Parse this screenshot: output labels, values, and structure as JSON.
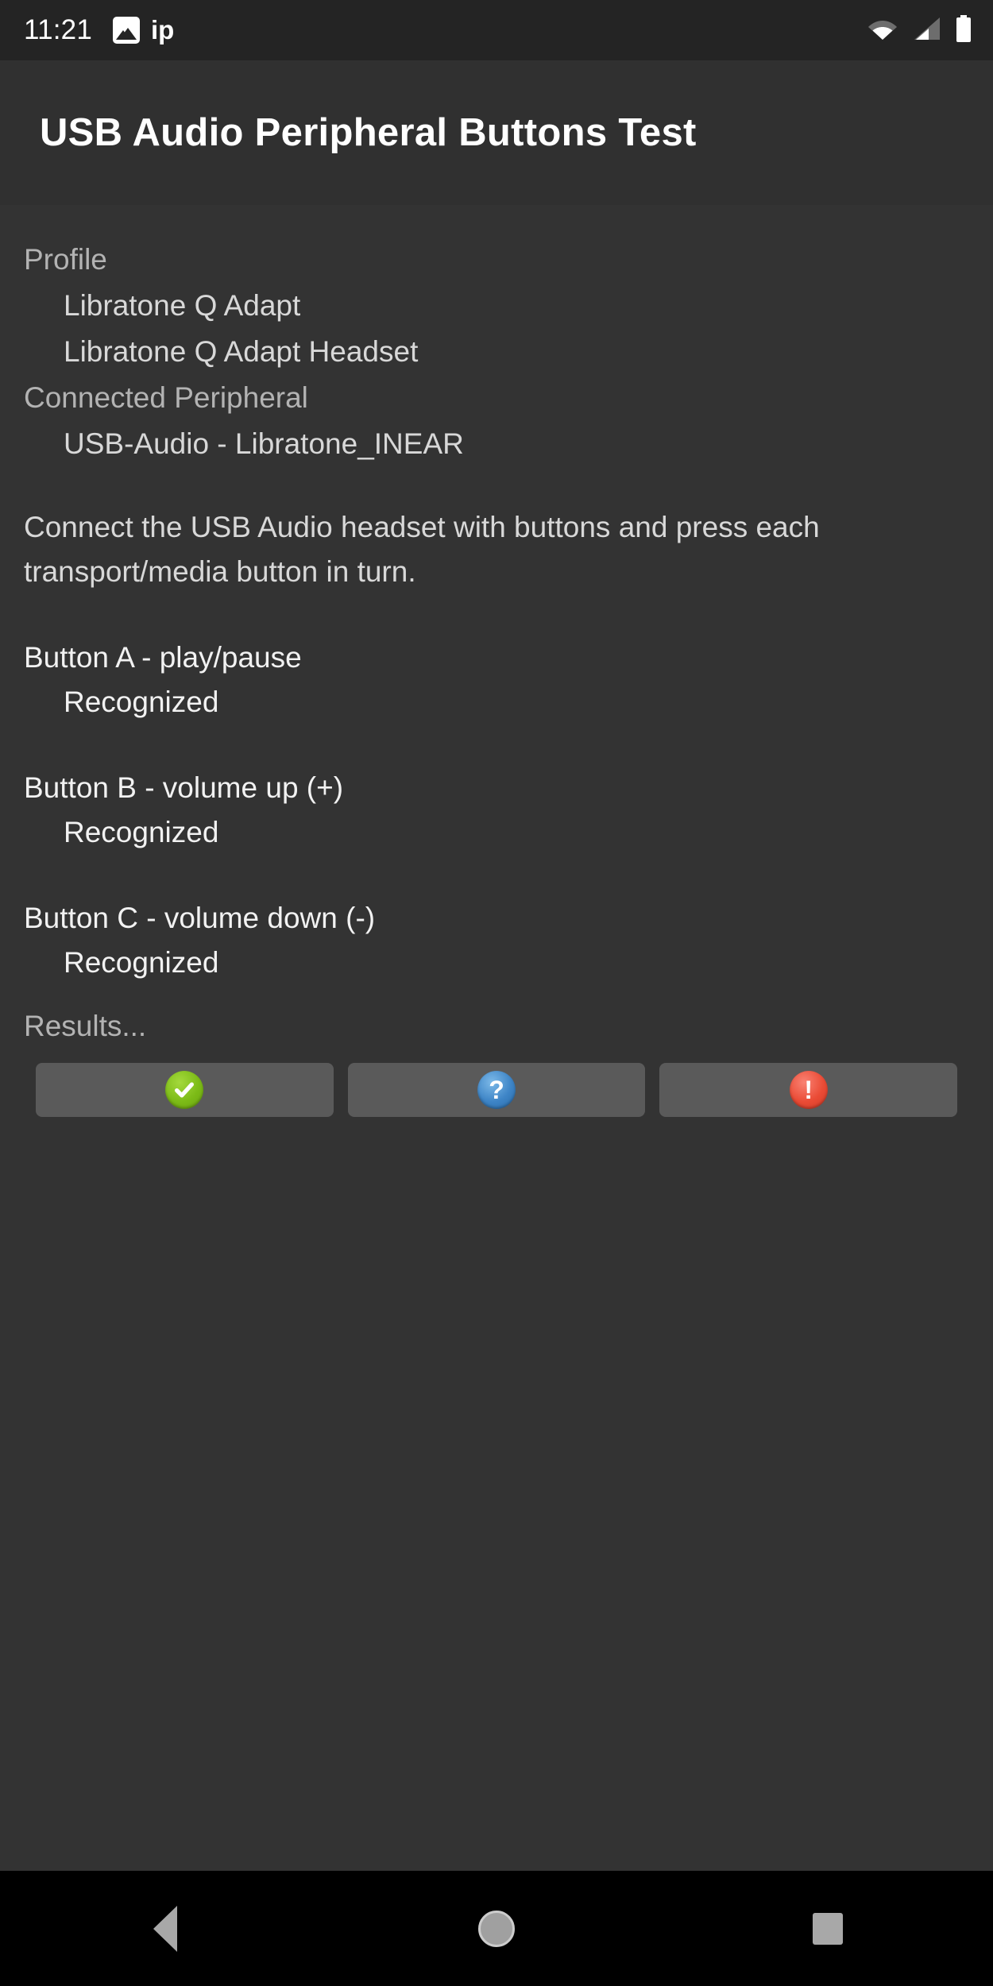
{
  "statusbar": {
    "clock": "11:21",
    "notification_icon": "image-icon",
    "notification_text": "ip",
    "wifi_icon": "wifi-icon",
    "signal_icon": "cellular-signal-icon",
    "battery_icon": "battery-full-icon"
  },
  "titlebar": {
    "title": "USB Audio Peripheral Buttons Test"
  },
  "info": {
    "profile_label": "Profile",
    "profile_value_1": "Libratone Q Adapt",
    "profile_value_2": "Libratone Q Adapt Headset",
    "peripheral_label": "Connected Peripheral",
    "peripheral_value": "USB-Audio - Libratone_INEAR"
  },
  "instructions": "Connect the USB Audio headset with buttons and press each transport/media button in turn.",
  "tests": [
    {
      "name": "Button A - play/pause",
      "status": "Recognized"
    },
    {
      "name": "Button B - volume up (+)",
      "status": "Recognized"
    },
    {
      "name": "Button C - volume down (-)",
      "status": "Recognized"
    }
  ],
  "results": {
    "label": "Results...",
    "buttons": [
      {
        "name": "pass-button",
        "icon": "check-icon",
        "glyph": "",
        "color": "#7cbb17"
      },
      {
        "name": "info-button",
        "icon": "question-icon",
        "glyph": "?",
        "color": "#3d84c6"
      },
      {
        "name": "fail-button",
        "icon": "exclamation-icon",
        "glyph": "!",
        "color": "#ea4b35"
      }
    ]
  },
  "navbar": {
    "back": "back-button",
    "home": "home-button",
    "recents": "recents-button"
  }
}
